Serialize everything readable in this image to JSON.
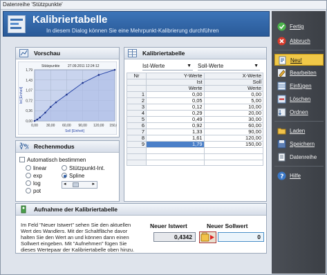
{
  "window": {
    "title": "Datenreihe 'Stützpunkte'"
  },
  "header": {
    "title": "Kalibriertabelle",
    "subtitle": "In diesem Dialog können Sie eine Mehrpunkt-Kalibrierung durchführen"
  },
  "vorschau": {
    "title": "Vorschau"
  },
  "chart_data": {
    "type": "line",
    "title": "Stützpunkte",
    "subtitle": "27.09.2011 12:24:12",
    "xlabel": "Soll [Einheit]",
    "ylabel": "Ist [Einheit]",
    "x": [
      0,
      5,
      10,
      20,
      30,
      40,
      60,
      90,
      120,
      150
    ],
    "y": [
      0,
      0.05,
      0.12,
      0.29,
      0.49,
      0.65,
      0.92,
      1.33,
      1.61,
      1.79
    ],
    "xticks": [
      "0,00",
      "30,00",
      "60,00",
      "90,00",
      "120,00",
      "150,00"
    ],
    "yticks": [
      "1,79",
      "1,43",
      "1,07",
      "0,72",
      "0,36",
      "0,00"
    ],
    "xlim": [
      0,
      150
    ],
    "ylim": [
      0,
      1.79
    ],
    "grid": true
  },
  "rechenmodus": {
    "title": "Rechenmodus",
    "auto_label": "Automatisch bestimmen",
    "options": [
      "linear",
      "exp",
      "log",
      "pot",
      "Stützpunkt-Int.",
      "Spline"
    ],
    "selected": "Spline",
    "slider_left": "◂",
    "slider_right": "▸"
  },
  "kalib": {
    "title": "Kalibriertabelle",
    "left_select": "Ist-Werte",
    "right_select": "Soll-Werte",
    "col_nr": "Nr",
    "col_y": "Y-Werte",
    "col_x": "X-Werte",
    "row_sub1": [
      "",
      "Ist",
      "Soll"
    ],
    "row_sub2": [
      "",
      "Werte",
      "Werte"
    ],
    "rows": [
      [
        "1",
        "0,00",
        "0,00"
      ],
      [
        "2",
        "0,05",
        "5,00"
      ],
      [
        "3",
        "0,12",
        "10,00"
      ],
      [
        "4",
        "0,29",
        "20,00"
      ],
      [
        "5",
        "0,49",
        "30,00"
      ],
      [
        "6",
        "0,92",
        "60,00"
      ],
      [
        "7",
        "1,33",
        "90,00"
      ],
      [
        "8",
        "1,61",
        "120,00"
      ],
      [
        "9",
        "1,79",
        "150,00"
      ]
    ],
    "blank_rows": 3
  },
  "aufnahme": {
    "title": "Aufnahme der Kalibriertabelle",
    "text": "Im Feld \"Neuer Istwert\" sehen Sie den aktuellen Wert des Wandlers. Mit der Schaltfläche davor halten Sie den Wert an und können dann einen Sollwert eingeben. Mit \"Aufnehmen\" fügen Sie dieses Wertepaar der Kalibriertabelle oben hinzu.",
    "ist_label": "Neuer Istwert",
    "soll_label": "Neuer Sollwert",
    "ist_value": "0,4342",
    "soll_value": "0"
  },
  "sidebar": {
    "fertig": "Fertig",
    "abbruch": "Abbruch",
    "neu": "Neu!",
    "bearbeiten": "Bearbeiten",
    "einfuegen": "Einfügen",
    "loeschen": "Löschen",
    "ordnen": "Ordnen",
    "laden": "Laden",
    "speichern": "Speichern",
    "datenreihe": "Datenreihe",
    "hilfe": "Hilfe"
  },
  "colors": {
    "accent": "#2a5a98",
    "active": "#f0c848",
    "sidebar": "#3b3f45"
  }
}
